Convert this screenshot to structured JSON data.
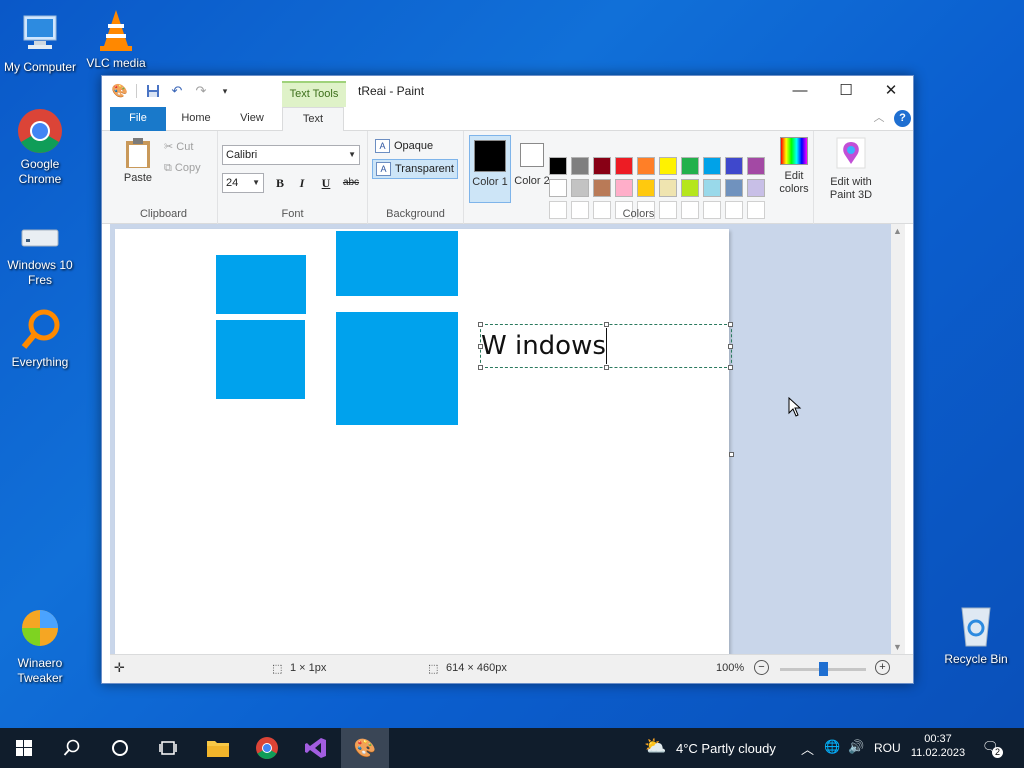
{
  "desktop": {
    "icons": [
      {
        "label": "My Computer"
      },
      {
        "label": "VLC media"
      },
      {
        "label": "Google Chrome"
      },
      {
        "label": "Windows 10 Fres"
      },
      {
        "label": "Everything"
      },
      {
        "label": "Winaero Tweaker"
      },
      {
        "label": "Recycle Bin"
      }
    ]
  },
  "window": {
    "title": "tReai - Paint",
    "context_tab": "Text Tools",
    "controls": {
      "minimize": "—",
      "maximize": "☐",
      "close": "✕"
    }
  },
  "tabs": {
    "file": "File",
    "home": "Home",
    "view": "View",
    "text": "Text",
    "help": "?"
  },
  "ribbon": {
    "clipboard": {
      "label": "Clipboard",
      "paste": "Paste",
      "cut": "Cut",
      "copy": "Copy"
    },
    "font": {
      "label": "Font",
      "family": "Calibri",
      "size": "24",
      "bold": "B",
      "italic": "I",
      "underline": "U",
      "strike": "abc"
    },
    "background": {
      "label": "Background",
      "opaque": "Opaque",
      "transparent": "Transparent"
    },
    "colors": {
      "label": "Colors",
      "color1": "Color 1",
      "color2": "Color 2",
      "edit": "Edit colors",
      "color1_value": "#000000",
      "color2_value": "#ffffff",
      "palette": [
        "#000000",
        "#7f7f7f",
        "#880015",
        "#ed1c24",
        "#ff7f27",
        "#fff200",
        "#22b14c",
        "#00a2e8",
        "#3f48cc",
        "#a349a4",
        "#ffffff",
        "#c3c3c3",
        "#b97a57",
        "#ffaec9",
        "#ffc90e",
        "#efe4b0",
        "#b5e61d",
        "#99d9ea",
        "#7092be",
        "#c8bfe7",
        "#ffffff",
        "#ffffff",
        "#ffffff",
        "#ffffff",
        "#ffffff",
        "#ffffff",
        "#ffffff",
        "#ffffff",
        "#ffffff",
        "#ffffff"
      ]
    },
    "paint3d": {
      "label": "Edit with Paint 3D"
    }
  },
  "canvas": {
    "text": "W indows",
    "tile_color": "#00a2ed"
  },
  "status": {
    "selection": "1 × 1px",
    "size": "614 × 460px",
    "zoom": "100%",
    "zoom_fraction": 0.5
  },
  "taskbar": {
    "weather": "4°C  Partly cloudy",
    "language": "ROU",
    "time": "00:37",
    "date": "11.02.2023",
    "notifications": "2"
  }
}
